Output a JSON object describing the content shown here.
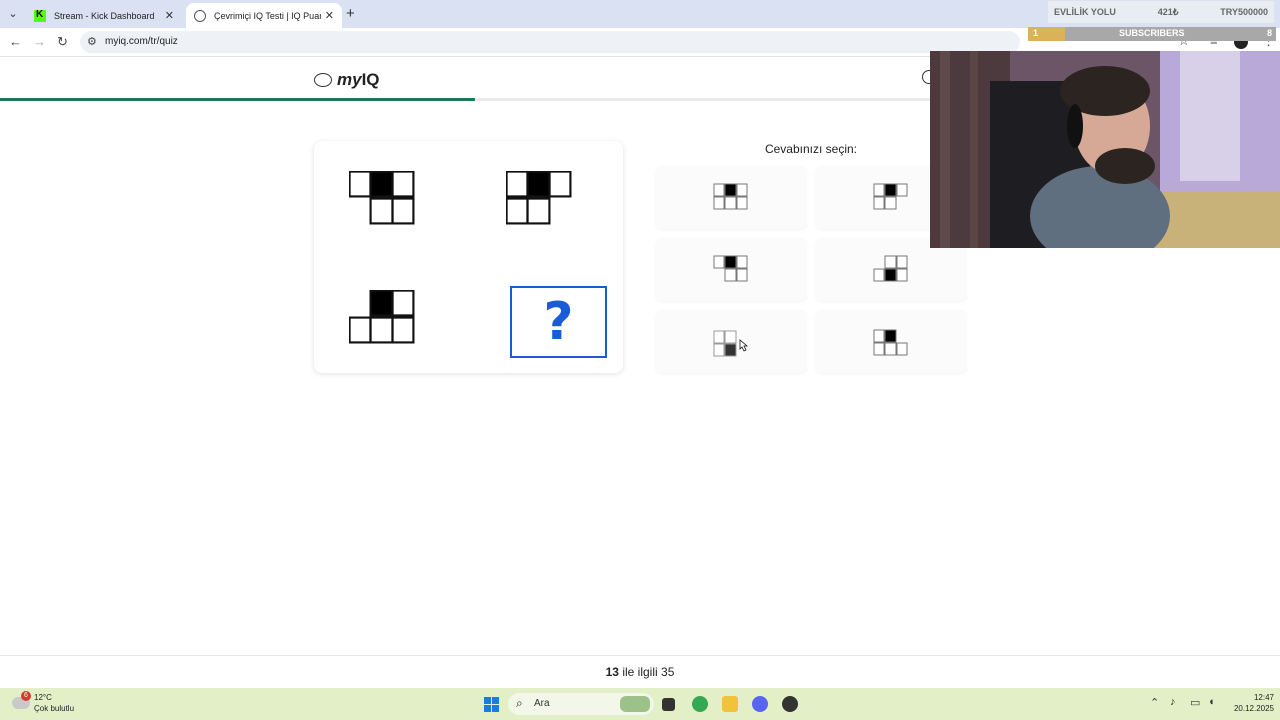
{
  "browser": {
    "tabs": [
      {
        "title": "Stream - Kick Dashboard"
      },
      {
        "title": "Çevrimiçi IQ Testi | IQ Puanınızı"
      }
    ],
    "url": "myiq.com/tr/quiz"
  },
  "stream_overlay": {
    "goal_name": "EVLİLİK YOLU",
    "goal_amount": "421₺",
    "goal_target": "TRY500000",
    "sub_count_left": "1",
    "sub_label": "SUBSCRIBERS",
    "sub_count_right": "8"
  },
  "header": {
    "logo_prefix": "my",
    "logo_suffix": "IQ",
    "progress_fraction": 0.371
  },
  "question": {
    "mark": "?"
  },
  "answers": {
    "title": "Cevabınızı seçin:"
  },
  "pager": {
    "current": "13",
    "middle": "ile ilgili",
    "total": "35"
  },
  "taskbar": {
    "weather_badge": "6",
    "temperature": "12°C",
    "weather_desc": "Çok bulutlu",
    "search_placeholder": "Ara",
    "time": "12:47",
    "date": "20.12.2025"
  },
  "colors": {
    "accent_blue": "#1a5cd8",
    "progress_green": "#1a7a5a"
  },
  "icons": [
    "tab-menu-icon",
    "close-icon",
    "plus-icon",
    "back-icon",
    "forward-icon",
    "reload-icon",
    "site-info-icon",
    "star-icon",
    "media-icon",
    "profile-icon",
    "menu-icon",
    "brain-icon",
    "timer-icon",
    "windows-icon",
    "search-icon"
  ]
}
